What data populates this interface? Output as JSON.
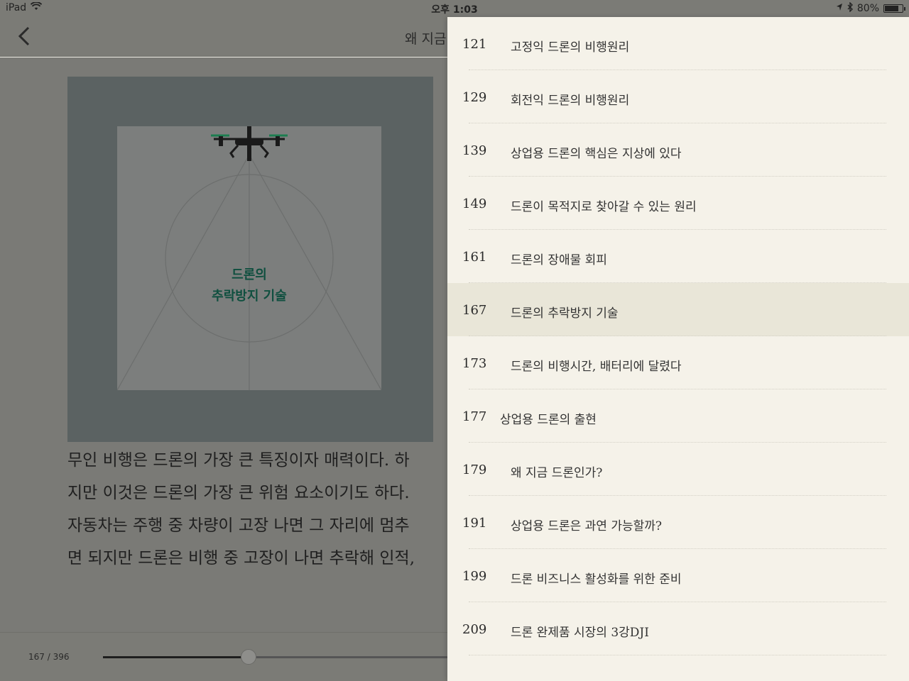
{
  "status_bar": {
    "device": "iPad",
    "time": "오후 1:03",
    "battery": "80%",
    "battery_level": 0.8
  },
  "header": {
    "title": "왜 지금"
  },
  "figure": {
    "caption_line1": "드론의",
    "caption_line2": "추락방지 기술"
  },
  "body_lines": [
    "무인 비행은 드론의 가장 큰 특징이자 매력이다. 하",
    "지만 이것은 드론의 가장 큰 위험 요소이기도 하다.",
    "자동차는 주행 중 차량이 고장 나면 그 자리에 멈추",
    "면 되지만 드론은 비행 중 고장이 나면 추락해 인적,"
  ],
  "progress": {
    "label": "167 / 396",
    "current": 167,
    "total": 396
  },
  "toc": [
    {
      "page": "121",
      "title": "고정익 드론의 비행원리"
    },
    {
      "page": "129",
      "title": "회전익 드론의 비행원리"
    },
    {
      "page": "139",
      "title": "상업용 드론의 핵심은 지상에 있다"
    },
    {
      "page": "149",
      "title": "드론이 목적지로 찾아갈 수 있는 원리"
    },
    {
      "page": "161",
      "title": "드론의 장애물 회피"
    },
    {
      "page": "167",
      "title": "드론의 추락방지 기술",
      "active": true
    },
    {
      "page": "173",
      "title": "드론의 비행시간, 배터리에 달렸다"
    },
    {
      "page": "177",
      "title": "상업용 드론의 출현",
      "section": true
    },
    {
      "page": "179",
      "title": "왜 지금 드론인가?"
    },
    {
      "page": "191",
      "title": "상업용 드론은 과연 가능할까?"
    },
    {
      "page": "199",
      "title": "드론 비즈니스 활성화를 위한 준비"
    },
    {
      "page": "209",
      "title": "드론 완제품 시장의 3강DJI"
    }
  ]
}
